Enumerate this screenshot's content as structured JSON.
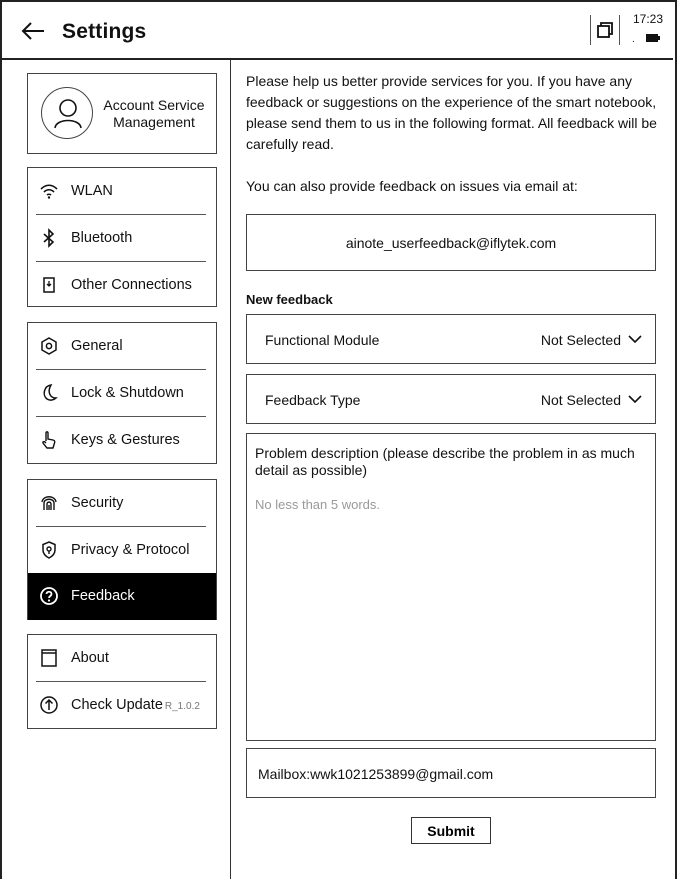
{
  "header": {
    "title": "Settings",
    "back_icon": "arrow-left-icon",
    "window_icon": "window-switch-icon"
  },
  "status": {
    "time": "17:23",
    "dot": ".",
    "battery_icon": "battery-icon"
  },
  "sidebar": {
    "account": {
      "label": "Account Service Management",
      "icon": "user-avatar-icon"
    },
    "connections": [
      {
        "label": "WLAN",
        "icon": "wifi-icon"
      },
      {
        "label": "Bluetooth",
        "icon": "bluetooth-icon"
      },
      {
        "label": "Other Connections",
        "icon": "connection-icon"
      }
    ],
    "system": [
      {
        "label": "General",
        "icon": "general-icon"
      },
      {
        "label": "Lock & Shutdown",
        "icon": "moon-icon"
      },
      {
        "label": "Keys & Gestures",
        "icon": "hand-pointer-icon"
      }
    ],
    "privacy": [
      {
        "label": "Security",
        "icon": "fingerprint-icon"
      },
      {
        "label": "Privacy & Protocol",
        "icon": "privacy-shield-icon"
      },
      {
        "label": "Feedback",
        "icon": "question-circle-icon",
        "active": true
      }
    ],
    "info": [
      {
        "label": "About",
        "icon": "about-icon"
      },
      {
        "label": "Check Update",
        "version": "R_1.0.2",
        "icon": "update-arrow-icon"
      }
    ]
  },
  "main": {
    "intro": "Please help us better provide services for you. If you have any feedback or suggestions on the experience of the smart notebook, please send them to us in the following format. All feedback will be carefully read.",
    "email_intro": "You can also provide feedback on issues via email at:",
    "email": "ainote_userfeedback@iflytek.com",
    "new_feedback_label": "New feedback",
    "functional_module": {
      "label": "Functional Module",
      "value": "Not Selected"
    },
    "feedback_type": {
      "label": "Feedback Type",
      "value": "Not Selected"
    },
    "description": {
      "label": "Problem description (please describe the problem in as much detail as possible)",
      "placeholder": "No less than 5 words."
    },
    "mailbox": "Mailbox:wwk1021253899@gmail.com",
    "submit_label": "Submit"
  }
}
